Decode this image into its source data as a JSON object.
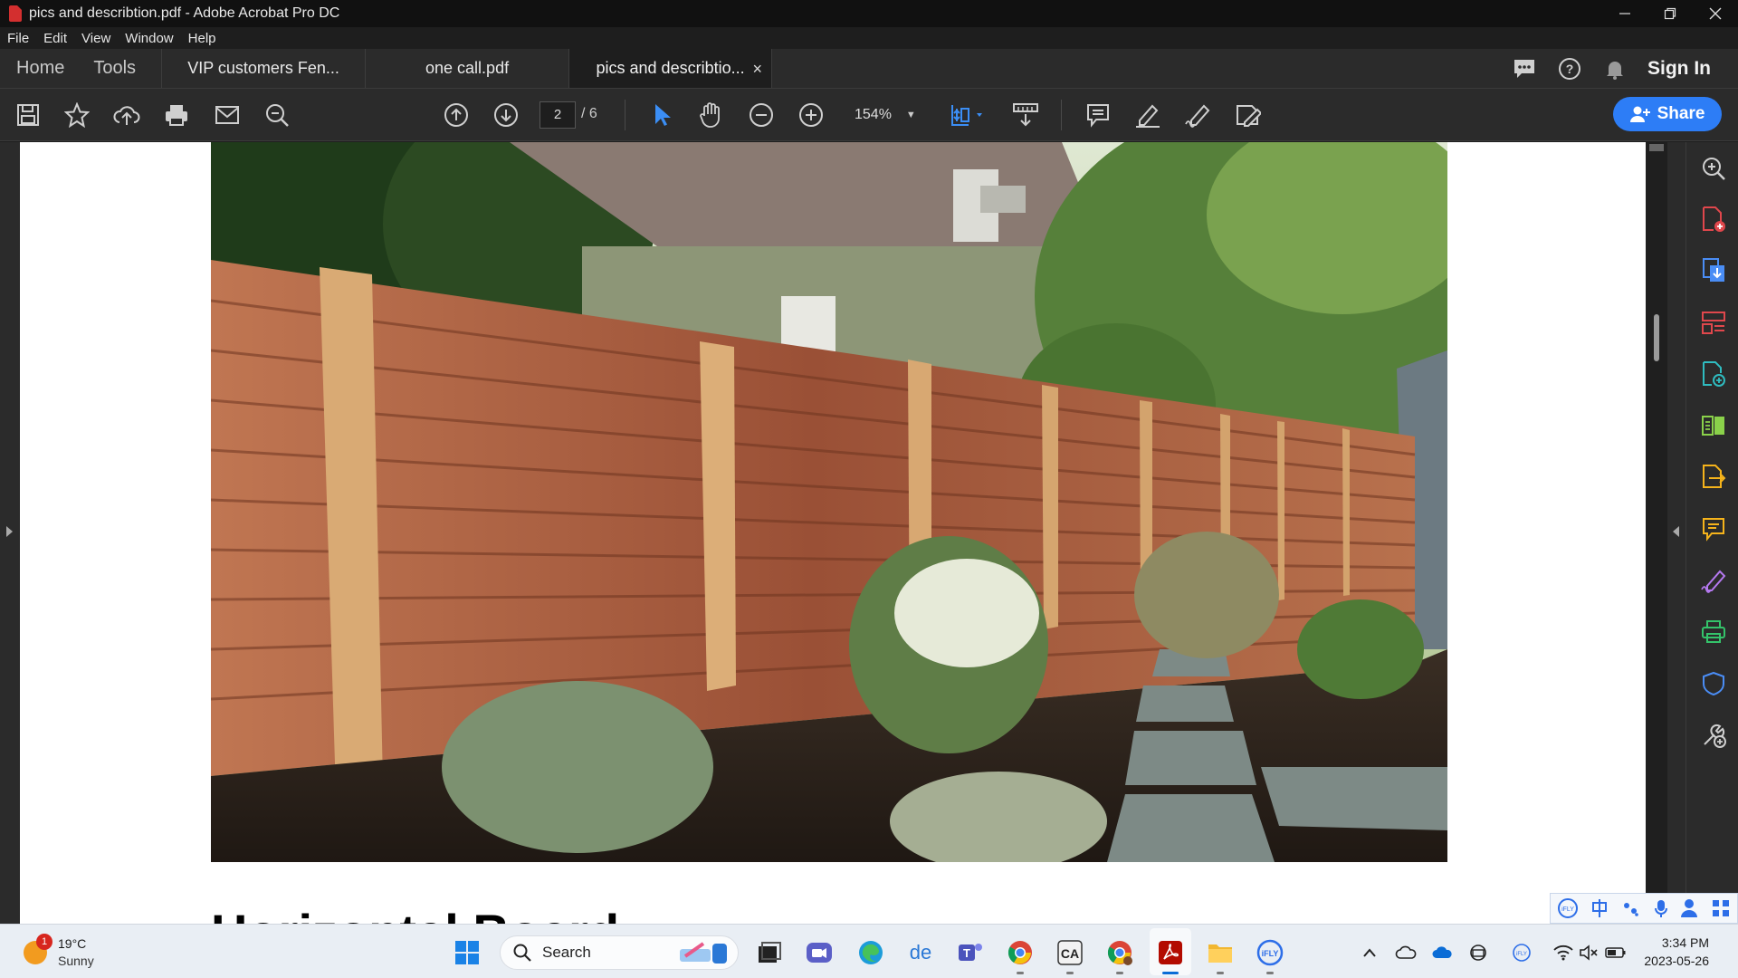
{
  "window": {
    "title": "pics and describtion.pdf - Adobe Acrobat Pro DC"
  },
  "menu": [
    "File",
    "Edit",
    "View",
    "Window",
    "Help"
  ],
  "tabs": {
    "home": "Home",
    "tools": "Tools",
    "documents": [
      {
        "label": "VIP customers  Fen...",
        "active": false
      },
      {
        "label": "one call.pdf",
        "active": false
      },
      {
        "label": "pics and describtio...",
        "active": true
      }
    ],
    "close": "×",
    "sign_in": "Sign In"
  },
  "toolbar": {
    "current_page": "2",
    "total_pages": "/ 6",
    "zoom": "154%",
    "share": "Share"
  },
  "document": {
    "heading": "Horizontal Board:"
  },
  "taskbar": {
    "weather_badge": "1",
    "temperature": "19°C",
    "condition": "Sunny",
    "search_label": "Search",
    "time": "3:34 PM",
    "date": "2023-05-26"
  },
  "colors": {
    "accent": "#2d7df6",
    "pdf_red": "#d32f2f"
  }
}
